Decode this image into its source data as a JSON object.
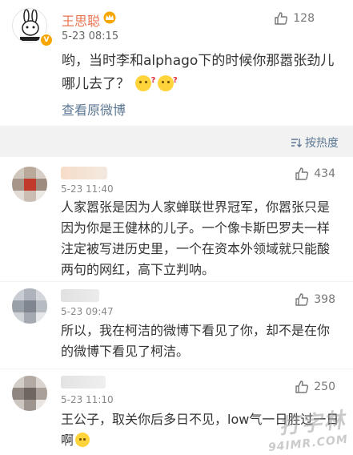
{
  "main_comment": {
    "username": "王思聪",
    "time": "5-23 08:15",
    "likes": "128",
    "text": "哟，当时李和alphago下的时候你那嚣张劲儿哪儿去了？",
    "view_original": "查看原微博"
  },
  "sort": {
    "label": "按热度"
  },
  "comments": [
    {
      "time": "5-23 11:40",
      "likes": "434",
      "text": "人家嚣张是因为人家蝉联世界冠军，你嚣张只是因为你是王健林的儿子。一个像卡斯巴罗夫一样注定被写进历史里，一个在资本外领域就只能酸两句的网红，高下立判呐。"
    },
    {
      "time": "5-23 09:47",
      "likes": "398",
      "text": "所以，我在柯洁的微博下看见了你，却不是在你的微博下看见了柯洁。"
    },
    {
      "time": "5-23 11:10",
      "likes": "250",
      "text": "王公子，取关你后多日不见，low气一日胜过一日啊"
    }
  ],
  "watermark": {
    "line1": "打字林",
    "line2": "94IMR.COM"
  },
  "colors": {
    "username": "#eb7350",
    "link": "#5d7895",
    "vip_badge": "#f7a600"
  }
}
